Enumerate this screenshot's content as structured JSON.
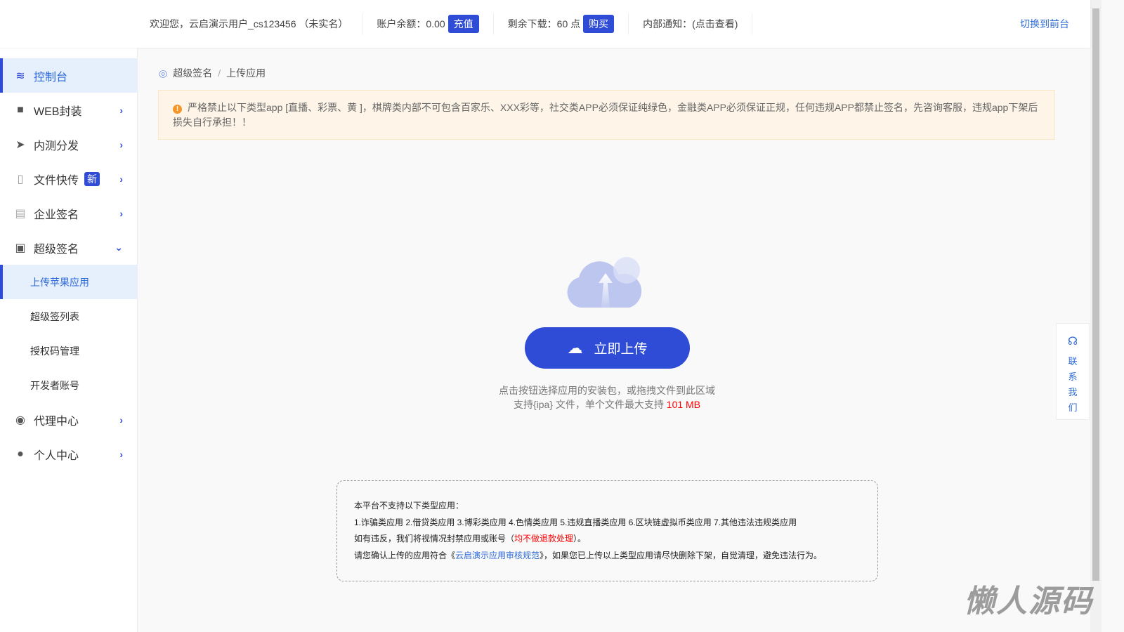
{
  "topbar": {
    "welcome": "欢迎您，云启演示用户_cs123456 （未实名）",
    "balance_label": "账户余额：0.00",
    "recharge": "充值",
    "downloads_label": "剩余下载：60 点",
    "buy": "购买",
    "notice": "内部通知：(点击查看)",
    "switch": "切换到前台"
  },
  "sidebar": {
    "items": [
      {
        "label": "控制台",
        "icon": "layers-icon"
      },
      {
        "label": "WEB封装",
        "icon": "box-icon"
      },
      {
        "label": "内测分发",
        "icon": "paper-plane-icon"
      },
      {
        "label": "文件快传",
        "icon": "zip-file-icon",
        "badge": "新"
      },
      {
        "label": "企业签名",
        "icon": "clipboard-icon"
      },
      {
        "label": "超级签名",
        "icon": "certificate-icon"
      },
      {
        "label": "代理中心",
        "icon": "agent-icon"
      },
      {
        "label": "个人中心",
        "icon": "user-icon"
      }
    ],
    "sub": [
      "上传苹果应用",
      "超级签列表",
      "授权码管理",
      "开发者账号"
    ]
  },
  "breadcrumb": [
    "超级签名",
    "/",
    "上传应用"
  ],
  "alert": "严格禁止以下类型app [直播、彩票、黄 ]，棋牌类内部不可包含百家乐、XXX彩等，社交类APP必须保证纯绿色，金融类APP必须保证正规，任何违规APP都禁止签名，先咨询客服，违规app下架后损失自行承担！！",
  "upload": {
    "button": "立即上传",
    "hint1": "点击按钮选择应用的安装包，或拖拽文件到此区域",
    "hint2": "支持{ipa} 文件，单个文件最大支持 ",
    "max": "101 MB"
  },
  "rules": {
    "l1": "本平台不支持以下类型应用：",
    "l2": "1.诈骗类应用 2.借贷类应用 3.博彩类应用 4.色情类应用 5.违规直播类应用 6.区块链虚拟币类应用 7.其他违法违规类应用",
    "l3a": "如有违反，我们将视情况封禁应用或账号（",
    "l3b": "均不做退款处理",
    "l3c": "）。",
    "l4a": "请您确认上传的应用符合《",
    "l4b": "云启演示应用审核规范",
    "l4c": "》，如果您已上传以上类型应用请尽快删除下架，自觉清理，避免违法行为。"
  },
  "contact": [
    "联",
    "系",
    "我",
    "们"
  ],
  "watermark": "懒人源码"
}
